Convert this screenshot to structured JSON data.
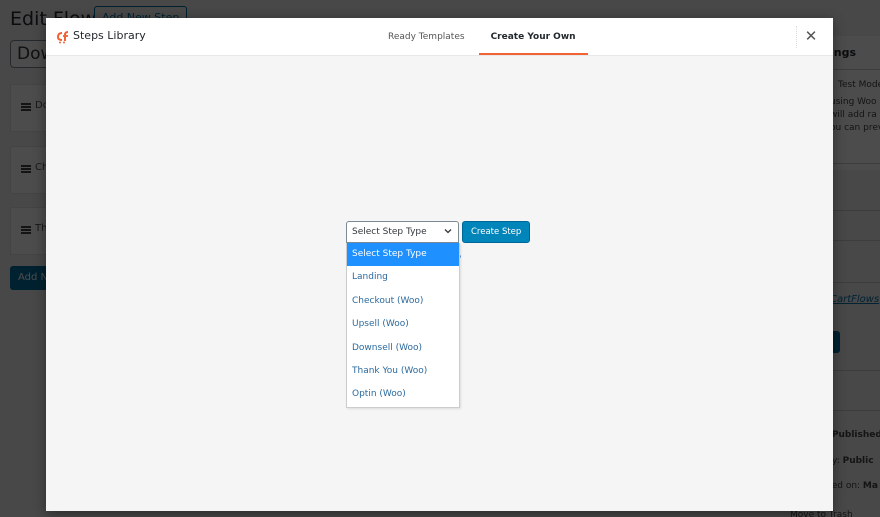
{
  "background": {
    "page_title": "Edit Flow",
    "add_new_step_top": "Add New Step",
    "flow_name_value": "Dow",
    "steps": [
      {
        "label": "Do"
      },
      {
        "label": "Ch"
      },
      {
        "label": "Th"
      }
    ],
    "add_new_step_bottom": "Add N",
    "sidebar": {
      "heading": "ings",
      "test_mode": "Test Mode",
      "desc_lines": [
        "using Woo",
        "will add ra",
        "ou can prev"
      ],
      "link_prefix": "o",
      "link_text": "CartFlows",
      "status_label": ": ",
      "status_value": "Published",
      "visibility_label": "ity: ",
      "visibility_value": "Public",
      "published_label": "hed on: ",
      "published_value": "Ma",
      "bottom_label": "Move to Trash"
    }
  },
  "modal": {
    "title": "Steps Library",
    "tabs": [
      {
        "label": "Ready Templates",
        "active": false
      },
      {
        "label": "Create Your Own",
        "active": true
      }
    ],
    "close_icon": "close-icon",
    "select": {
      "current_value": "Select Step Type",
      "options": [
        {
          "label": "Select Step Type",
          "selected": true
        },
        {
          "label": "Landing",
          "selected": false
        },
        {
          "label": "Checkout (Woo)",
          "selected": false
        },
        {
          "label": "Upsell (Woo)",
          "selected": false
        },
        {
          "label": "Downsell (Woo)",
          "selected": false
        },
        {
          "label": "Thank You (Woo)",
          "selected": false
        },
        {
          "label": "Optin (Woo)",
          "selected": false
        }
      ]
    },
    "create_button": "Create Step"
  },
  "colors": {
    "accent_orange": "#f16334",
    "primary_blue": "#0085ba",
    "option_highlight": "#1e90ff",
    "option_text": "#2b6a9e"
  }
}
